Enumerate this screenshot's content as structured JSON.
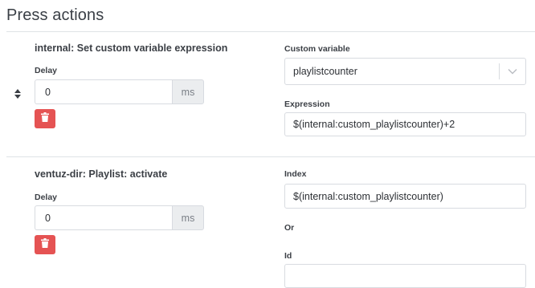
{
  "section": {
    "title": "Press actions"
  },
  "actions": [
    {
      "title": "internal: Set custom variable expression",
      "delay_label": "Delay",
      "delay_value": "0",
      "delay_unit": "ms",
      "fields": {
        "variable_label": "Custom variable",
        "variable_value": "playlistcounter",
        "expression_label": "Expression",
        "expression_value": "$(internal:custom_playlistcounter)+2"
      }
    },
    {
      "title": "ventuz-dir: Playlist: activate",
      "delay_label": "Delay",
      "delay_value": "0",
      "delay_unit": "ms",
      "fields": {
        "index_label": "Index",
        "index_value": "$(internal:custom_playlistcounter)",
        "or_label": "Or",
        "id_label": "Id",
        "id_value": ""
      }
    }
  ],
  "icons": {
    "reorder": "sort-handle-icon",
    "delete": "trash-icon",
    "dropdown": "chevron-down-icon"
  },
  "colors": {
    "danger": "#e55353",
    "text": "#3b3f45",
    "border": "#d8dbe0",
    "addon_bg": "#ebedef"
  }
}
